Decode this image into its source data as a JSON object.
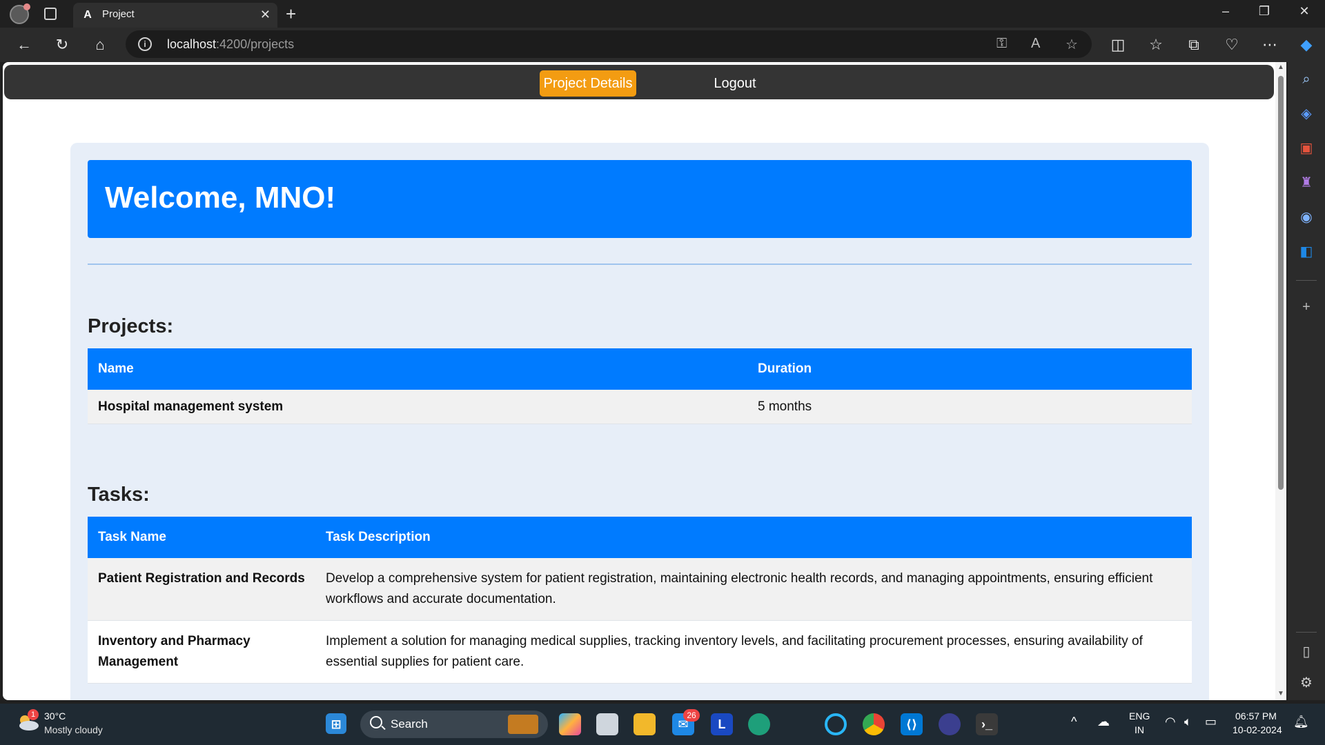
{
  "browser": {
    "tab_title": "Project",
    "tab_favicon": "A",
    "url_host": "localhost",
    "url_rest": ":4200/projects"
  },
  "app": {
    "nav": {
      "project_details": "Project Details",
      "logout": "Logout"
    },
    "welcome": "Welcome, MNO!",
    "projects_heading": "Projects:",
    "projects_table": {
      "headers": [
        "Name",
        "Duration"
      ],
      "rows": [
        {
          "name": "Hospital management system",
          "duration": "5 months"
        }
      ]
    },
    "tasks_heading": "Tasks:",
    "tasks_table": {
      "headers": [
        "Task Name",
        "Task Description"
      ],
      "rows": [
        {
          "name": "Patient Registration and Records",
          "description": "Develop a comprehensive system for patient registration, maintaining electronic health records, and managing appointments, ensuring efficient workflows and accurate documentation."
        },
        {
          "name": "Inventory and Pharmacy Management",
          "description": "Implement a solution for managing medical supplies, tracking inventory levels, and facilitating procurement processes, ensuring availability of essential supplies for patient care."
        }
      ]
    }
  },
  "taskbar": {
    "weather_temp": "30°C",
    "weather_desc": "Mostly cloudy",
    "weather_badge": "1",
    "search_label": "Search",
    "mail_badge": "26",
    "lang_top": "ENG",
    "lang_bottom": "IN",
    "time": "06:57 PM",
    "date": "10-02-2024"
  },
  "colors": {
    "primary": "#007bff",
    "accent": "#f39c12",
    "navbar": "#343434"
  }
}
